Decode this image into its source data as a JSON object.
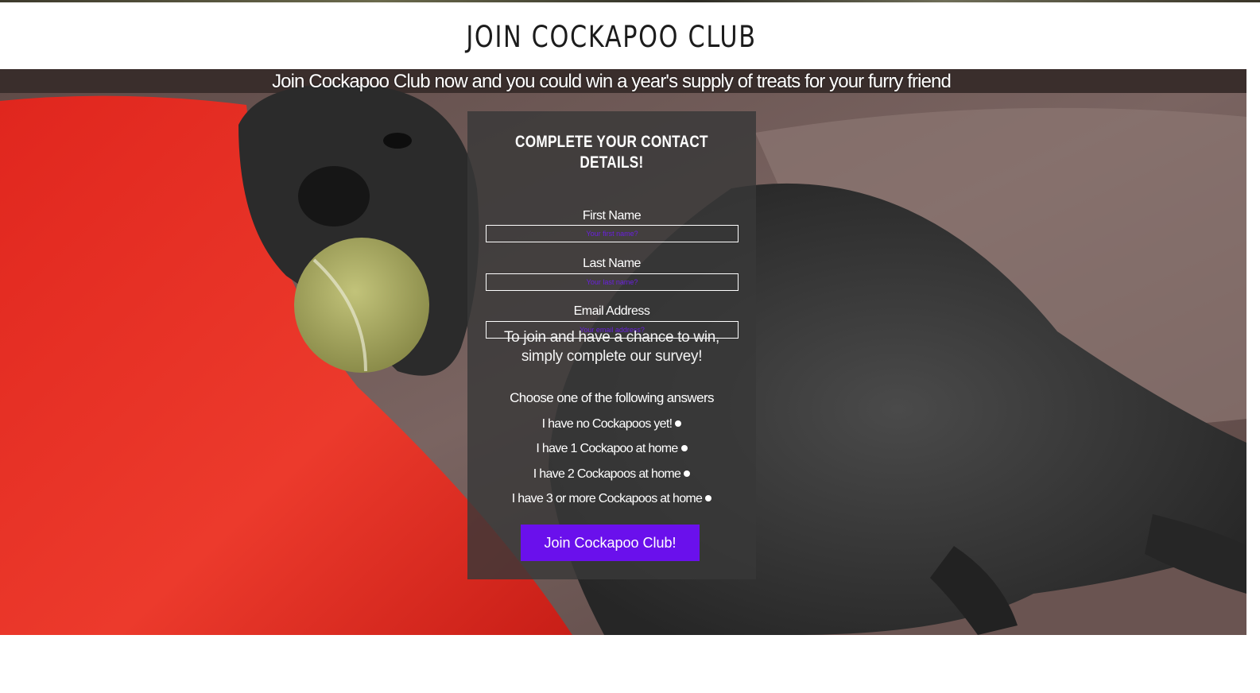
{
  "header": {
    "title": "JOIN COCKAPOO CLUB"
  },
  "hero": {
    "promo": "Join Cockapoo Club now and you could win a year's supply of treats for your furry friend",
    "photo": "photo of a black cockapoo on a red cushion and brown leather sofa holding a tennis ball"
  },
  "form": {
    "heading": "COMPLETE YOUR CONTACT DETAILS!",
    "fields": [
      {
        "label": "First Name",
        "value": "",
        "placeholder": "Your first name?"
      },
      {
        "label": "Last Name",
        "value": "",
        "placeholder": "Your last name?"
      },
      {
        "label": "Email Address",
        "value": "",
        "placeholder": "Your email address?"
      }
    ],
    "survey_intro": "To join and have a chance to win, simply complete our survey!",
    "survey_question": "Choose one of the following answers",
    "options": [
      {
        "label": "I have no Cockapoos yet!"
      },
      {
        "label": "I have 1 Cockapoo at home"
      },
      {
        "label": "I have 2 Cockapoos at home"
      },
      {
        "label": "I have 3 or more Cockapoos at home"
      }
    ],
    "submit_label": "Join Cockapoo Club!"
  },
  "colors": {
    "accent": "#6a10ec",
    "panel": "#383838",
    "placeholder": "#6a1fe0"
  }
}
